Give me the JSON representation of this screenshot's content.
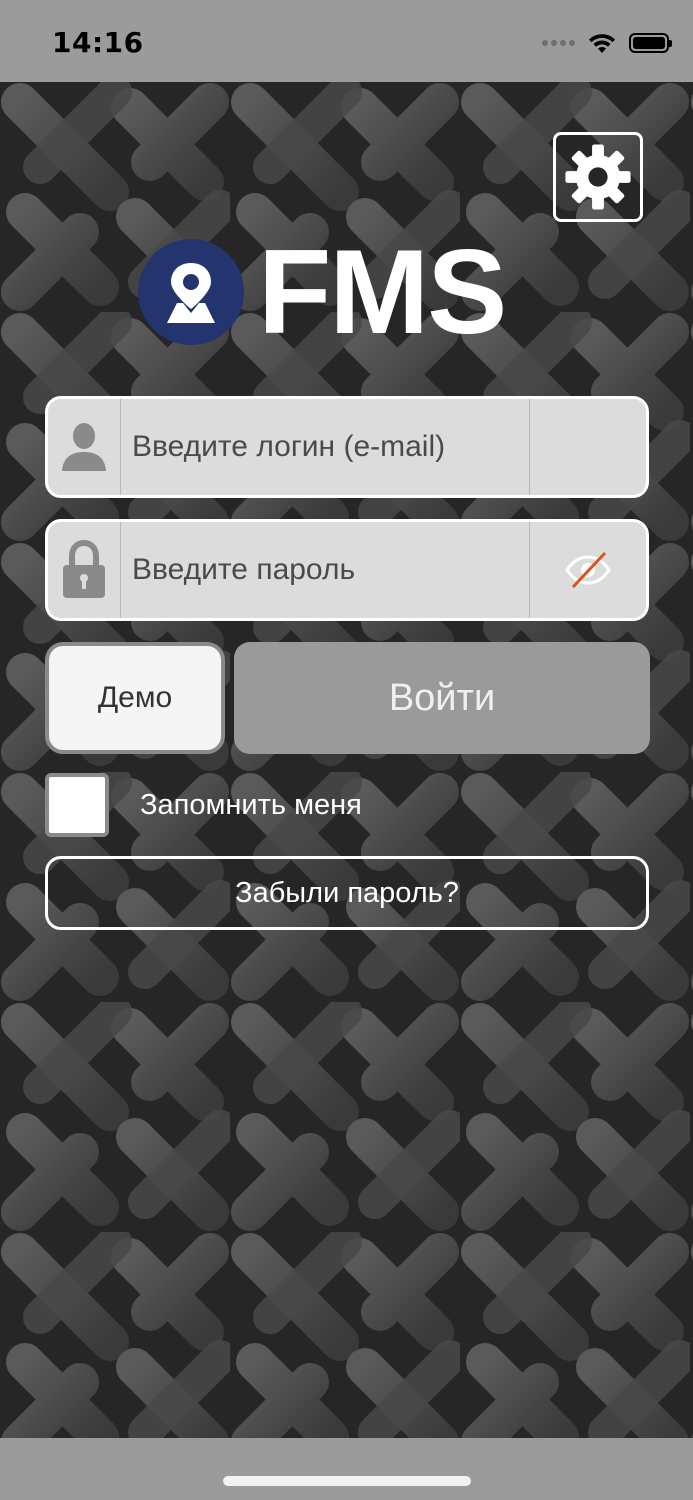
{
  "status_bar": {
    "time": "14:16",
    "icons": [
      "cellular-signal-icon",
      "wifi-icon",
      "battery-icon"
    ]
  },
  "header": {
    "settings_icon": "gear-icon",
    "logo_icon": "map-pin-icon",
    "logo_text": "FMS"
  },
  "login_form": {
    "login_field": {
      "placeholder": "Введите логин (e-mail)",
      "value": "",
      "icon": "user-icon"
    },
    "password_field": {
      "placeholder": "Введите пароль",
      "value": "",
      "icon": "lock-icon",
      "toggle_icon": "eye-slash-icon"
    },
    "demo_label": "Демо",
    "login_label": "Войти",
    "remember_label": "Запомнить меня",
    "remember_checked": false,
    "forgot_label": "Забыли пароль?"
  },
  "colors": {
    "logo_badge": "#23346e",
    "field_bg": "#dcdcdc",
    "login_button_bg": "#9a9a9a",
    "eye_slash": "#d9531e"
  }
}
